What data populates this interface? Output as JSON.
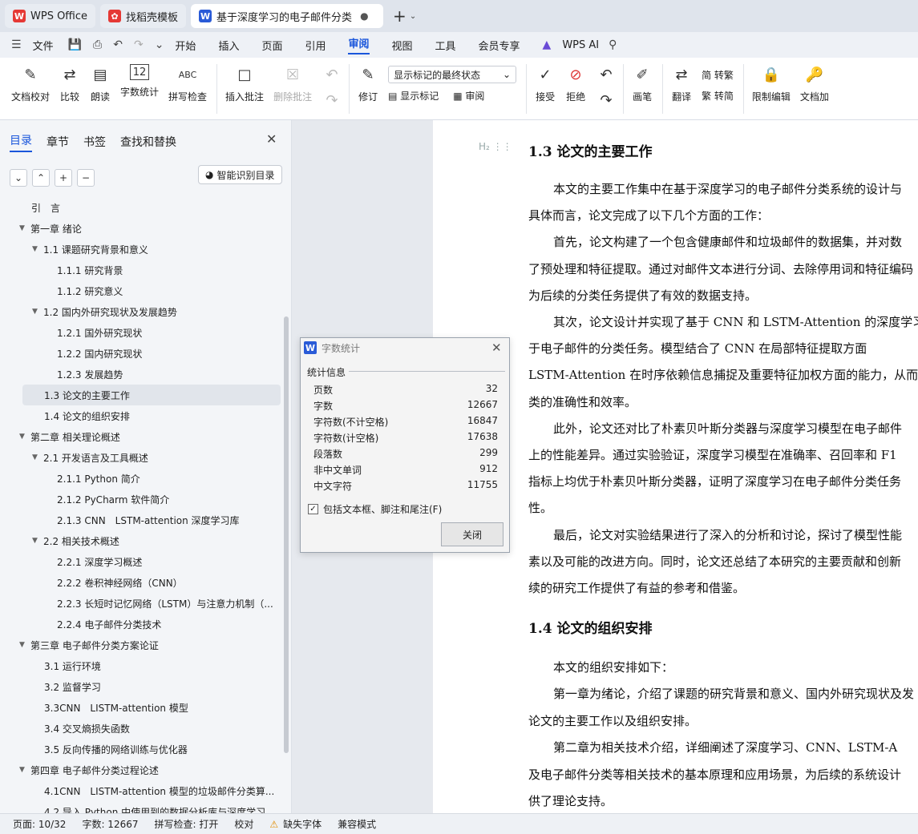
{
  "tabs": [
    {
      "label": "WPS Office",
      "icon": "wps-logo-icon"
    },
    {
      "label": "找稻壳模板",
      "icon": "docer-logo-icon"
    },
    {
      "label": "基于深度学习的电子邮件分类",
      "icon": "writer-logo-icon",
      "active": true
    }
  ],
  "menu": {
    "file": "文件",
    "items": [
      "开始",
      "插入",
      "页面",
      "引用",
      "审阅",
      "视图",
      "工具",
      "会员专享"
    ],
    "active": "审阅",
    "ai": "WPS AI"
  },
  "ribbon": {
    "group1": [
      "文档校对",
      "比较",
      "朗读",
      "字数统计",
      "拼写检查"
    ],
    "insert_comment": "插入批注",
    "delete_comment": "删除批注",
    "markup_select": "显示标记的最终状态",
    "revise": "修订",
    "show_markup": "显示标记",
    "review": "审阅",
    "accept": "接受",
    "reject": "拒绝",
    "pen": "画笔",
    "translate": "翻译",
    "to_trad": "简 转繁",
    "to_simp": "繁 转简",
    "restrict": "限制编辑",
    "doc_encrypt": "文档加"
  },
  "left_pane": {
    "tabs": [
      "目录",
      "章节",
      "书签",
      "查找和替换"
    ],
    "active_tab": "目录",
    "smart_toc": "智能识别目录",
    "toc": [
      {
        "label": "引　言",
        "level": 0,
        "arrow": false
      },
      {
        "label": "第一章  绪论",
        "level": 0,
        "arrow": true
      },
      {
        "label": "1.1  课题研究背景和意义",
        "level": 1,
        "arrow": true
      },
      {
        "label": "1.1.1  研究背景",
        "level": 2,
        "arrow": false
      },
      {
        "label": "1.1.2  研究意义",
        "level": 2,
        "arrow": false
      },
      {
        "label": "1.2  国内外研究现状及发展趋势",
        "level": 1,
        "arrow": true
      },
      {
        "label": "1.2.1  国外研究现状",
        "level": 2,
        "arrow": false
      },
      {
        "label": "1.2.2  国内研究现状",
        "level": 2,
        "arrow": false
      },
      {
        "label": "1.2.3  发展趋势",
        "level": 2,
        "arrow": false
      },
      {
        "label": "1.3  论文的主要工作",
        "level": 1,
        "arrow": false,
        "selected": true
      },
      {
        "label": "1.4  论文的组织安排",
        "level": 1,
        "arrow": false
      },
      {
        "label": "第二章  相关理论概述",
        "level": 0,
        "arrow": true
      },
      {
        "label": "2.1  开发语言及工具概述",
        "level": 1,
        "arrow": true
      },
      {
        "label": "2.1.1 Python 简介",
        "level": 2,
        "arrow": false
      },
      {
        "label": "2.1.2 PyCharm 软件简介",
        "level": 2,
        "arrow": false
      },
      {
        "label": "2.1.3 CNN　LSTM-attention 深度学习库",
        "level": 2,
        "arrow": false
      },
      {
        "label": "2.2  相关技术概述",
        "level": 1,
        "arrow": true
      },
      {
        "label": "2.2.1  深度学习概述",
        "level": 2,
        "arrow": false
      },
      {
        "label": "2.2.2  卷积神经网络（CNN）",
        "level": 2,
        "arrow": false
      },
      {
        "label": "2.2.3  长短时记忆网络（LSTM）与注意力机制（...",
        "level": 2,
        "arrow": false
      },
      {
        "label": "2.2.4  电子邮件分类技术",
        "level": 2,
        "arrow": false
      },
      {
        "label": "第三章  电子邮件分类方案论证",
        "level": 0,
        "arrow": true
      },
      {
        "label": "3.1 运行环境",
        "level": 1,
        "arrow": false
      },
      {
        "label": "3.2 监督学习",
        "level": 1,
        "arrow": false
      },
      {
        "label": "3.3CNN　LISTM-attention 模型",
        "level": 1,
        "arrow": false
      },
      {
        "label": "3.4 交叉熵损失函数",
        "level": 1,
        "arrow": false
      },
      {
        "label": "3.5 反向传播的网络训练与优化器",
        "level": 1,
        "arrow": false
      },
      {
        "label": "第四章  电子邮件分类过程论述",
        "level": 0,
        "arrow": true
      },
      {
        "label": "4.1CNN　LISTM-attention 模型的垃圾邮件分类算...",
        "level": 1,
        "arrow": false
      },
      {
        "label": "4.2 导入 Python 中使用到的数据分析库与深度学习...",
        "level": 1,
        "arrow": false
      }
    ]
  },
  "document": {
    "heading1": "1.3  论文的主要工作",
    "lines1": [
      "本文的主要工作集中在基于深度学习的电子邮件分类系统的设计与",
      "具体而言，论文完成了以下几个方面的工作：",
      "首先，论文构建了一个包含健康邮件和垃圾邮件的数据集，并对数",
      "了预处理和特征提取。通过对邮件文本进行分词、去除停用词和特征编码",
      "为后续的分类任务提供了有效的数据支持。",
      "其次，论文设计并实现了基于 CNN 和 LSTM-Attention 的深度学习",
      "于电子邮件的分类任务。模型结合了 CNN 在局部特征提取方面",
      "LSTM-Attention 在时序依赖信息捕捉及重要特征加权方面的能力，从而",
      "类的准确性和效率。",
      "此外，论文还对比了朴素贝叶斯分类器与深度学习模型在电子邮件",
      "上的性能差异。通过实验验证，深度学习模型在准确率、召回率和 F1",
      "指标上均优于朴素贝叶斯分类器，证明了深度学习在电子邮件分类任务",
      "性。",
      "最后，论文对实验结果进行了深入的分析和讨论，探讨了模型性能",
      "素以及可能的改进方向。同时，论文还总结了本研究的主要贡献和创新",
      "续的研究工作提供了有益的参考和借鉴。"
    ],
    "heading2": "1.4  论文的组织安排",
    "lines2": [
      "本文的组织安排如下：",
      "第一章为绪论，介绍了课题的研究背景和意义、国内外研究现状及发",
      "论文的主要工作以及组织安排。",
      "第二章为相关技术介绍，详细阐述了深度学习、CNN、LSTM-A",
      "及电子邮件分类等相关技术的基本原理和应用场景，为后续的系统设计",
      "供了理论支持。"
    ]
  },
  "dialog": {
    "title": "字数统计",
    "section": "统计信息",
    "rows": [
      {
        "label": "页数",
        "value": "32"
      },
      {
        "label": "字数",
        "value": "12667"
      },
      {
        "label": "字符数(不计空格)",
        "value": "16847"
      },
      {
        "label": "字符数(计空格)",
        "value": "17638"
      },
      {
        "label": "段落数",
        "value": "299"
      },
      {
        "label": "非中文单词",
        "value": "912"
      },
      {
        "label": "中文字符",
        "value": "11755"
      }
    ],
    "checkbox": "包括文本框、脚注和尾注(F)",
    "checked": true,
    "close": "关闭"
  },
  "status": {
    "page": "页面: 10/32",
    "words": "字数: 12667",
    "spell": "拼写检查: 打开",
    "proof": "校对",
    "missing_font": "缺失字体",
    "compat": "兼容模式"
  }
}
